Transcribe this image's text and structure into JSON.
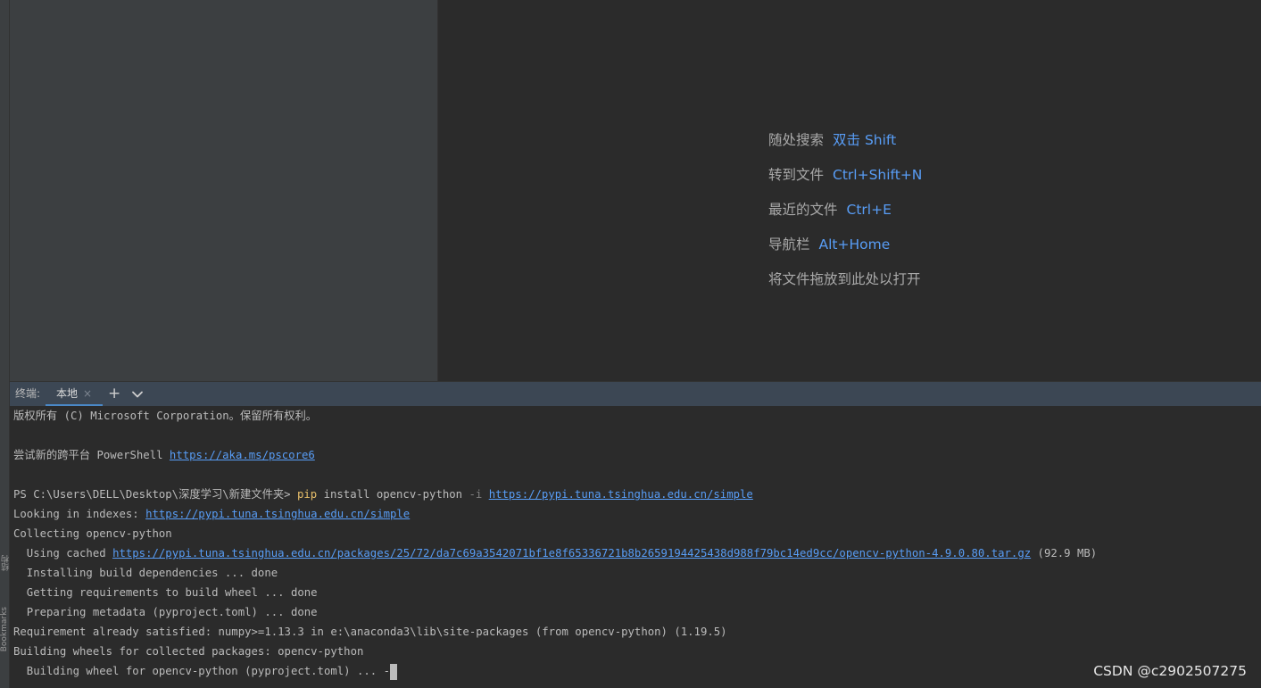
{
  "side_tools": [
    "结构",
    "Bookmarks"
  ],
  "editor_hints": [
    {
      "label": "随处搜索",
      "key": "双击 Shift"
    },
    {
      "label": "转到文件",
      "key": "Ctrl+Shift+N"
    },
    {
      "label": "最近的文件",
      "key": "Ctrl+E"
    },
    {
      "label": "导航栏",
      "key": "Alt+Home"
    },
    {
      "label": "将文件拖放到此处以打开",
      "key": ""
    }
  ],
  "terminal": {
    "title": "终端:",
    "tab_label": "本地",
    "tab_close": "×",
    "add_label": "+",
    "copyright": "版权所有 (C) Microsoft Corporation。保留所有权利。",
    "try_text": "尝试新的跨平台 PowerShell ",
    "try_link": "https://aka.ms/pscore6",
    "prompt": "PS C:\\Users\\DELL\\Desktop\\深度学习\\新建文件夹> ",
    "cmd": "pip",
    "cmd_args": " install opencv-python ",
    "cmd_opt": "-i",
    "cmd_url": "https://pypi.tuna.tsinghua.edu.cn/simple",
    "looking_prefix": "Looking in indexes: ",
    "looking_url": "https://pypi.tuna.tsinghua.edu.cn/simple",
    "collecting": "Collecting opencv-python",
    "cached_prefix": "  Using cached ",
    "cached_url": "https://pypi.tuna.tsinghua.edu.cn/packages/25/72/da7c69a3542071bf1e8f65336721b8b2659194425438d988f79bc14ed9cc/opencv-python-4.9.0.80.tar.gz",
    "cached_size": " (92.9 MB)",
    "line_build_deps": "  Installing build dependencies ... done",
    "line_get_req": "  Getting requirements to build wheel ... done",
    "line_prep_meta": "  Preparing metadata (pyproject.toml) ... done",
    "line_req_sat": "Requirement already satisfied: numpy>=1.13.3 in e:\\anaconda3\\lib\\site-packages (from opencv-python) (1.19.5)",
    "line_building": "Building wheels for collected packages: opencv-python",
    "line_build_wheel": "  Building wheel for opencv-python (pyproject.toml) ... -"
  },
  "watermark": "CSDN @c2902507275",
  "colors": {
    "link": "#589df6",
    "pip": "#e8bf6a",
    "tab_underline": "#4a88c7"
  }
}
